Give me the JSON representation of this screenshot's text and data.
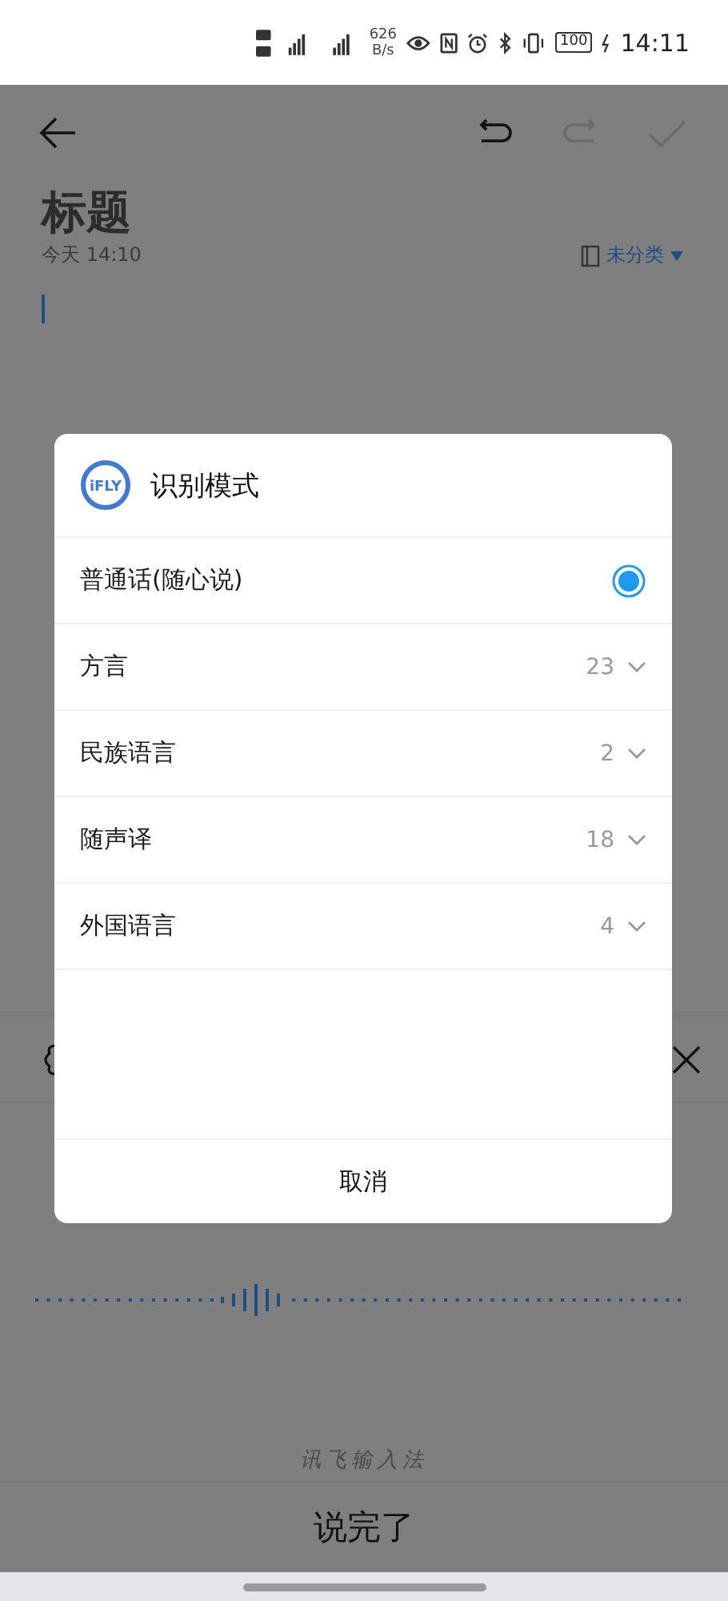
{
  "status_bar": {
    "network_speed": "626",
    "speed_unit": "B/s",
    "battery": "100",
    "time": "14:11"
  },
  "toolbar": {
    "actions": [
      {
        "kind": "undo",
        "disabled": false
      },
      {
        "kind": "redo",
        "disabled": true
      },
      {
        "kind": "confirm",
        "disabled": true
      }
    ]
  },
  "note": {
    "title": "标题",
    "date": "今天 14:10",
    "category": "未分类"
  },
  "dialog": {
    "logo": "iFLY",
    "title": "识别模式",
    "options": [
      {
        "label": "普通话(随心说)",
        "kind": "radio",
        "selected": true
      },
      {
        "label": "方言",
        "kind": "group",
        "count": "23",
        "selected": false
      },
      {
        "label": "民族语言",
        "kind": "group",
        "count": "2",
        "selected": false
      },
      {
        "label": "随声译",
        "kind": "group",
        "count": "18",
        "selected": false
      },
      {
        "label": "外国语言",
        "kind": "group",
        "count": "4",
        "selected": false
      }
    ],
    "cancel": "取消"
  },
  "voice_input": {
    "brand": "讯飞输入法",
    "done_button": "说完了"
  }
}
